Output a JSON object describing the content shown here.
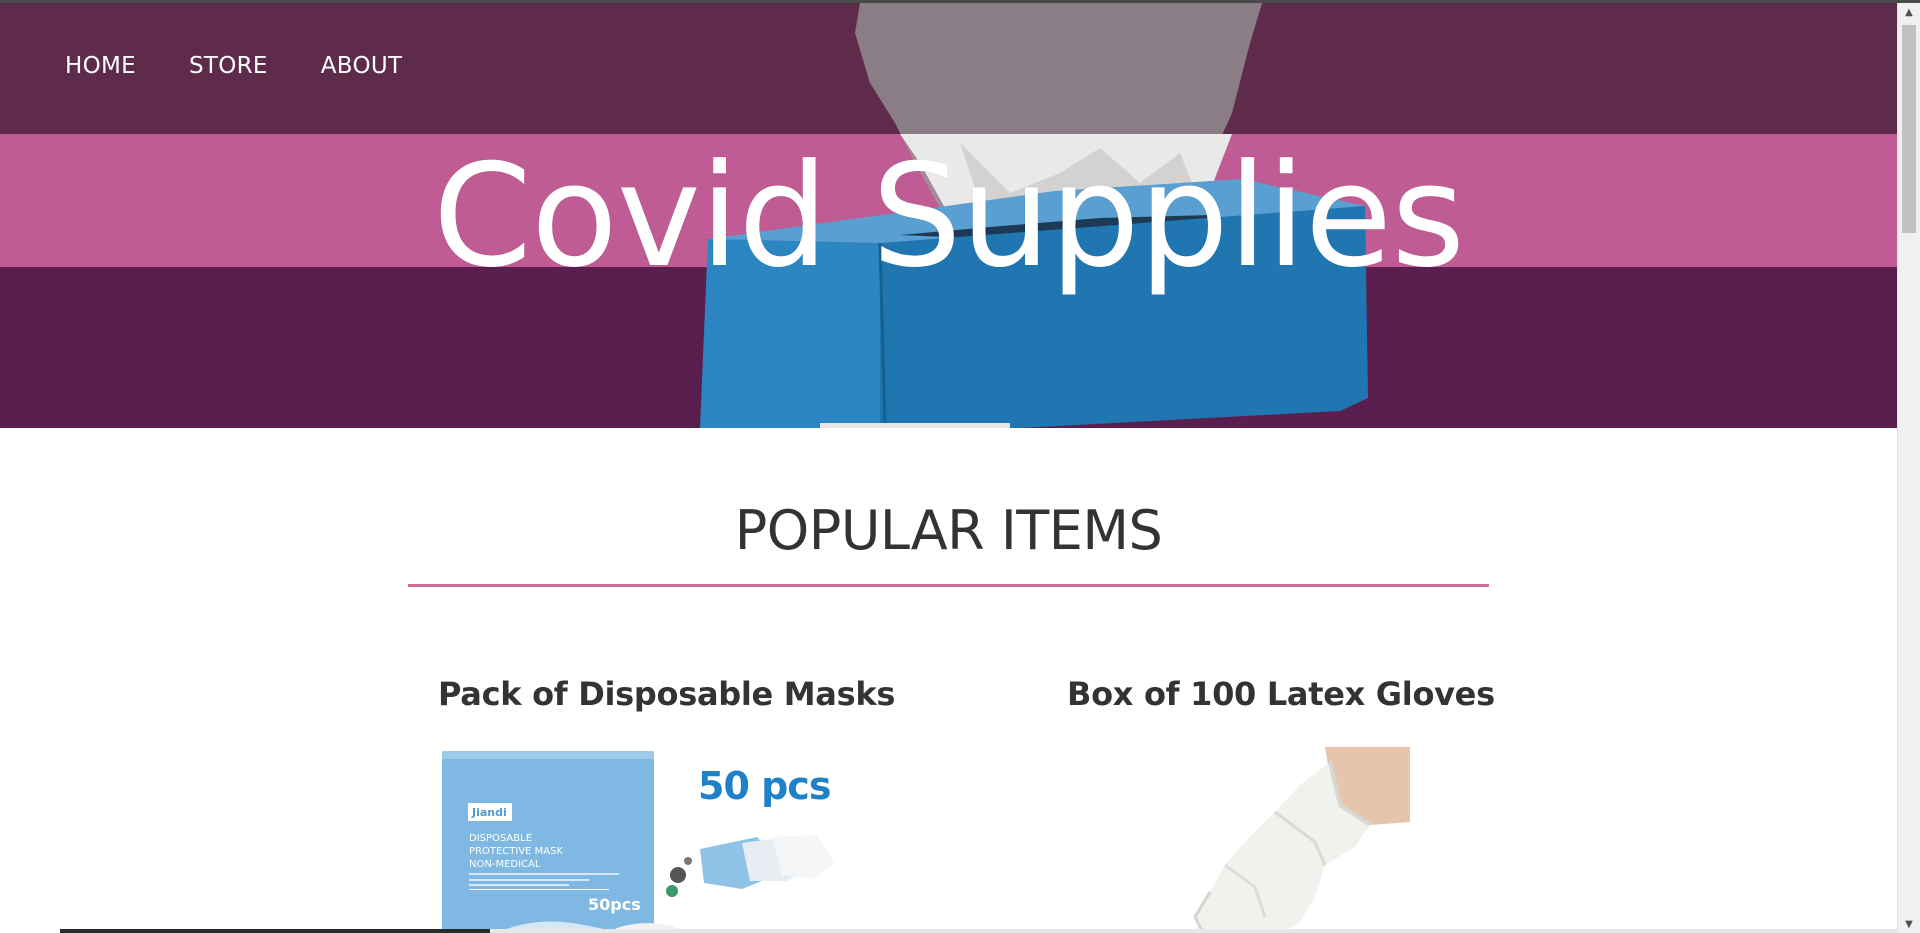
{
  "nav": {
    "home": "HOME",
    "store": "STORE",
    "about": "ABOUT"
  },
  "hero": {
    "title": "Covid Supplies"
  },
  "popular": {
    "heading": "POPULAR ITEMS",
    "items": [
      {
        "title": "Pack of Disposable Masks",
        "package_brand": "Jiandi",
        "package_line1": "DISPOSABLE",
        "package_line2": "PROTECTIVE MASK",
        "package_line3": "NON-MEDICAL",
        "package_count": "50pcs",
        "badge": "50 pcs"
      },
      {
        "title": "Box of 100 Latex Gloves"
      }
    ]
  },
  "colors": {
    "nav_band": "#5e2b4b",
    "pink_band": "#bf5c93",
    "plum_band": "#5a1f4e",
    "rule": "#cc6f98",
    "tissue_box": "#2b86c1"
  }
}
